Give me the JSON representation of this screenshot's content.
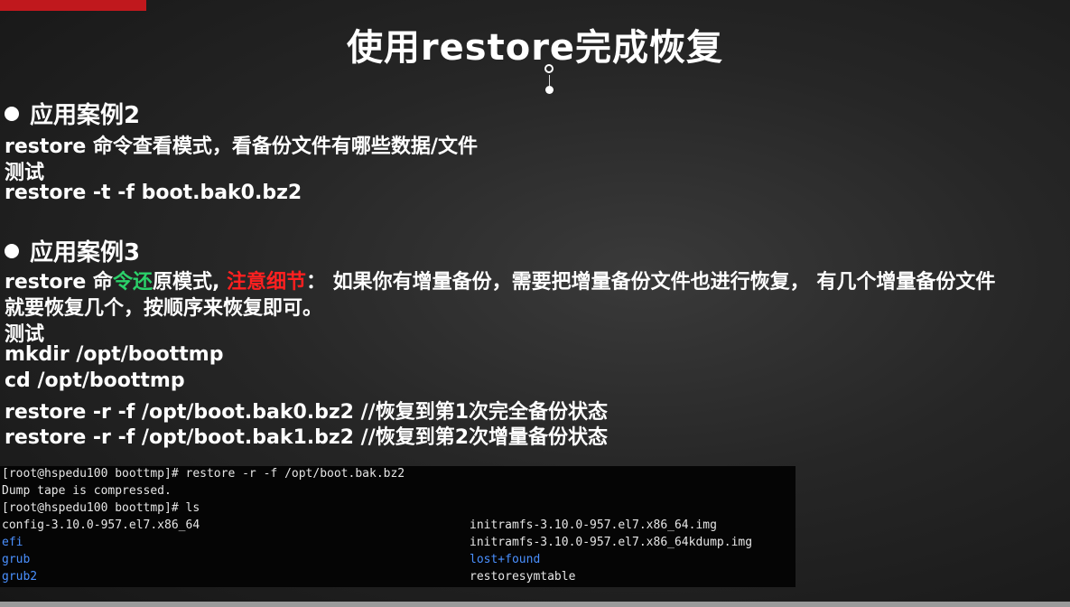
{
  "slide": {
    "corner_label": "",
    "title": "使用restore完成恢复"
  },
  "case2": {
    "heading": "应用案例2",
    "desc": "restore 命令查看模式，看备份文件有哪些数据/文件",
    "test_label": "测试",
    "command": "restore -t -f boot.bak0.bz2"
  },
  "case3": {
    "heading": "应用案例3",
    "desc_prefix": "restore 命",
    "desc_highlight": "令还",
    "desc_mid": "原模式, ",
    "desc_warning": "注意细节",
    "desc_rest": "： 如果你有增量备份，需要把增量备份文件也进行恢复， 有几个增量备份文件",
    "desc_line2": "就要恢复几个，按顺序来恢复即可。",
    "test_label": "测试",
    "commands": [
      "mkdir /opt/boottmp",
      "cd /opt/boottmp",
      "restore -r -f /opt/boot.bak0.bz2 //恢复到第1次完全备份状态",
      "restore -r -f /opt/boot.bak1.bz2 //恢复到第2次增量备份状态"
    ]
  },
  "terminal": {
    "lines": [
      "[root@hspedu100 boottmp]# restore -r -f /opt/boot.bak.bz2",
      "Dump tape is compressed.",
      "[root@hspedu100 boottmp]# ls"
    ],
    "listing_left": [
      "config-3.10.0-957.el7.x86_64",
      "efi",
      "grub",
      "grub2"
    ],
    "listing_right": [
      "initramfs-3.10.0-957.el7.x86_64.img",
      "initramfs-3.10.0-957.el7.x86_64kdump.img",
      "lost+found",
      "restoresymtable"
    ],
    "colors": {
      "dir": "#4a90ff",
      "file": "#e6e6e6"
    }
  }
}
